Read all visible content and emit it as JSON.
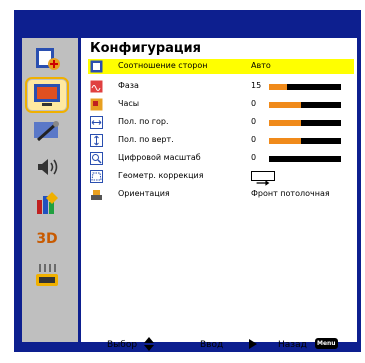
{
  "menu": {
    "title": "Конфигурация",
    "rows": [
      {
        "label": "Соотношение сторон",
        "value": "Авто",
        "highlighted": true,
        "icon": "aspect-ratio-icon"
      },
      {
        "label": "Фаза",
        "value": "15",
        "bar": 0.25,
        "icon": "phase-icon"
      },
      {
        "label": "Часы",
        "value": "0",
        "bar": 0.45,
        "icon": "clock-icon"
      },
      {
        "label": "Пол. по гор.",
        "value": "0",
        "bar": 0.45,
        "icon": "h-position-icon"
      },
      {
        "label": "Пол. по верт.",
        "value": "0",
        "bar": 0.45,
        "icon": "v-position-icon"
      },
      {
        "label": "Цифровой масштаб",
        "value": "0",
        "bar": 0.0,
        "icon": "digital-zoom-icon"
      },
      {
        "label": "Геометр. коррекция",
        "value": "",
        "icon": "keystone-icon"
      },
      {
        "label": "Ориентация",
        "value": "Фронт потолочная",
        "icon": "projection-icon"
      }
    ]
  },
  "sidebar": {
    "items": [
      {
        "icon": "color-settings-icon"
      },
      {
        "icon": "display-config-icon",
        "selected": true
      },
      {
        "icon": "setup-tools-icon"
      },
      {
        "icon": "audio-icon"
      },
      {
        "icon": "options-icon"
      },
      {
        "icon": "3d-icon",
        "label": "3D"
      },
      {
        "icon": "network-icon"
      }
    ]
  },
  "footer": {
    "select": "Выбор",
    "enter": "Ввод",
    "back": "Назад",
    "menu_badge": "Menu"
  },
  "colors": {
    "frame": "#0d1f8f",
    "highlight": "#ffff00",
    "bar_fill": "#f08a1a",
    "bar_track": "#000000",
    "selected_outline": "#f0b000"
  }
}
